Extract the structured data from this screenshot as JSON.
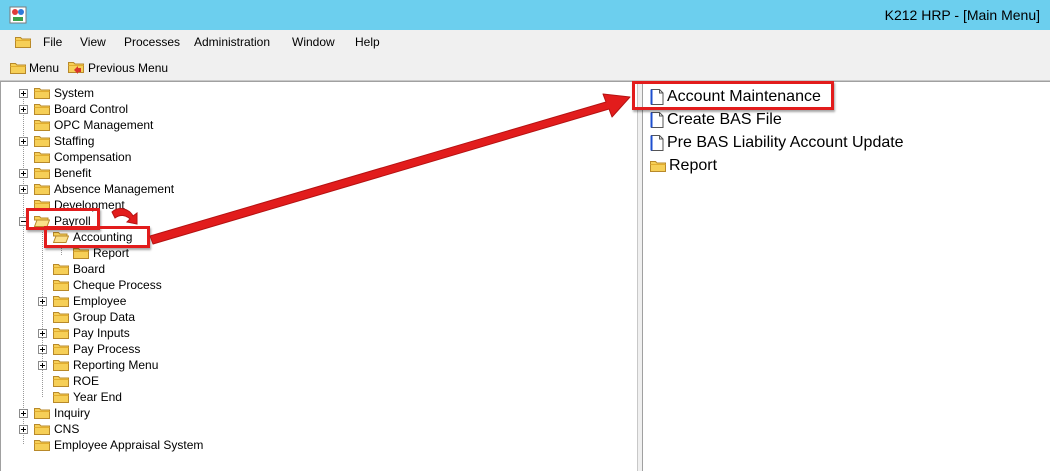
{
  "window": {
    "title": "K212 HRP - [Main Menu]"
  },
  "menu": {
    "items": [
      "File",
      "View",
      "Processes",
      "Administration",
      "Window",
      "Help"
    ]
  },
  "toolbar": {
    "menu_label": "Menu",
    "previous_label": "Previous Menu"
  },
  "tree": {
    "items": [
      {
        "label": "System"
      },
      {
        "label": "Board Control"
      },
      {
        "label": "OPC Management"
      },
      {
        "label": "Staffing"
      },
      {
        "label": "Compensation"
      },
      {
        "label": "Benefit"
      },
      {
        "label": "Absence Management"
      },
      {
        "label": "Development"
      },
      {
        "label": "Payroll"
      },
      {
        "label": "Accounting"
      },
      {
        "label": "Report"
      },
      {
        "label": "Board"
      },
      {
        "label": "Cheque Process"
      },
      {
        "label": "Employee"
      },
      {
        "label": "Group Data"
      },
      {
        "label": "Pay Inputs"
      },
      {
        "label": "Pay Process"
      },
      {
        "label": "Reporting Menu"
      },
      {
        "label": "ROE"
      },
      {
        "label": "Year End"
      },
      {
        "label": "Inquiry"
      },
      {
        "label": "CNS"
      },
      {
        "label": "Employee Appraisal System"
      }
    ]
  },
  "right_list": {
    "items": [
      {
        "label": "Account Maintenance"
      },
      {
        "label": "Create BAS File"
      },
      {
        "label": "Pre BAS Liability Account Update"
      },
      {
        "label": "Report"
      }
    ]
  },
  "colors": {
    "titlebar": "#6ccfee",
    "annotation": "#e21c1c",
    "folder": "#f5c542"
  }
}
